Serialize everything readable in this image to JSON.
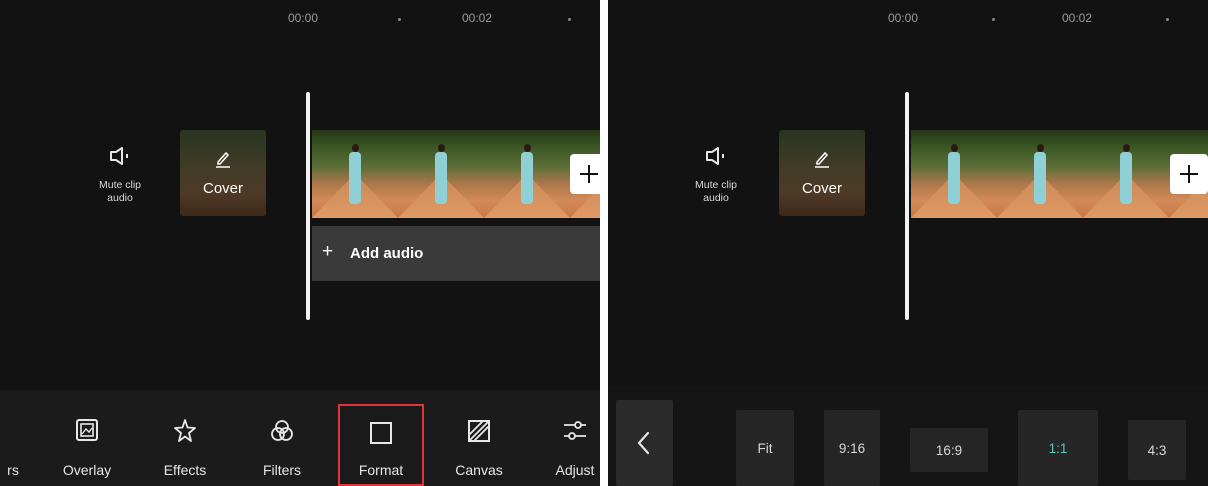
{
  "timeline": {
    "time_start": "00:00",
    "time_mid": "00:02"
  },
  "mute_clip": {
    "label_line1": "Mute clip",
    "label_line2": "audio",
    "icon": "speaker-icon"
  },
  "cover": {
    "label": "Cover",
    "icon": "pencil-icon"
  },
  "add_clip": {
    "icon": "plus-icon"
  },
  "add_audio": {
    "plus": "+",
    "label": "Add audio"
  },
  "toolbar": {
    "partial_label": "rs",
    "items": [
      {
        "label": "Overlay",
        "icon": "overlay-icon"
      },
      {
        "label": "Effects",
        "icon": "effects-sparkle-icon"
      },
      {
        "label": "Filters",
        "icon": "filters-icon"
      },
      {
        "label": "Format",
        "icon": "format-square-icon",
        "highlighted": true
      },
      {
        "label": "Canvas",
        "icon": "canvas-icon"
      },
      {
        "label": "Adjust",
        "icon": "adjust-sliders-icon"
      }
    ]
  },
  "format_panel": {
    "back_icon": "chevron-left-icon",
    "ratios": [
      {
        "label": "Fit"
      },
      {
        "label": "9:16"
      },
      {
        "label": "16:9"
      },
      {
        "label": "1:1",
        "selected": true
      },
      {
        "label": "4:3"
      }
    ]
  },
  "colors": {
    "background": "#121212",
    "highlight_border": "#e3343a",
    "selected_ratio": "#55c9c0",
    "audio_bar": "#3a3a3a"
  }
}
